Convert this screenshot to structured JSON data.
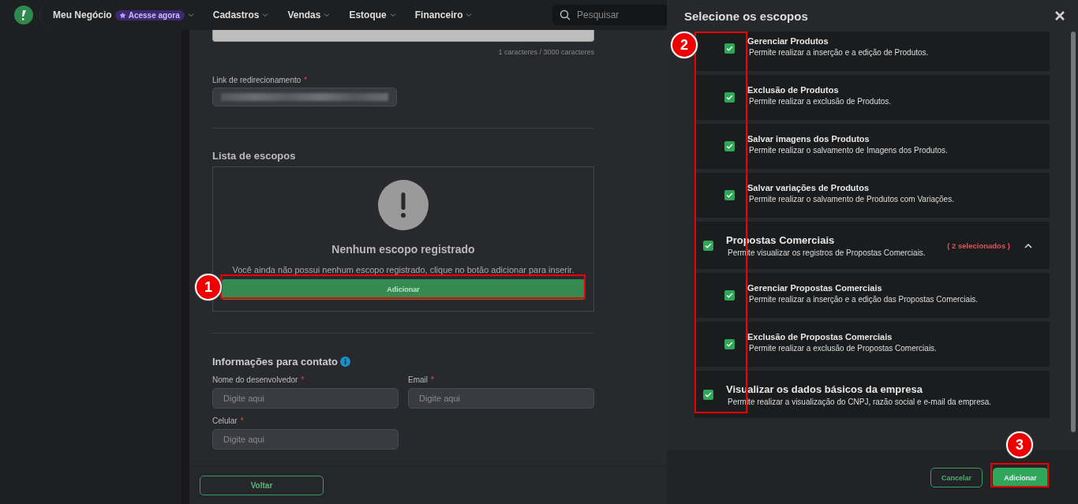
{
  "nav": {
    "brand_menu": {
      "label": "Meu Negócio",
      "badge": "Acesse agora"
    },
    "items": [
      {
        "label": "Cadastros"
      },
      {
        "label": "Vendas"
      },
      {
        "label": "Estoque"
      },
      {
        "label": "Financeiro"
      }
    ],
    "search": {
      "placeholder": "Pesquisar"
    }
  },
  "form": {
    "char_count": "1 caracteres / 3000 caracteres",
    "redirect": {
      "label": "Link de redirecionamento",
      "required_mark": "*"
    },
    "scopes_section": {
      "title": "Lista de escopos",
      "empty_title": "Nenhum escopo registrado",
      "empty_text": "Você ainda não possui nenhum escopo registrado, clique no botão adicionar para inserir.",
      "button": "Adicionar"
    },
    "contact": {
      "title": "Informações para contato",
      "fields": [
        {
          "label": "Nome do desenvolvedor",
          "required_mark": "*",
          "placeholder": "Digite aqui"
        },
        {
          "label": "Email",
          "required_mark": "*",
          "placeholder": "Digite aqui"
        },
        {
          "label": "Celular",
          "required_mark": "*",
          "placeholder": "Digite aqui"
        }
      ]
    },
    "back_button": "Voltar"
  },
  "drawer": {
    "title": "Selecione os escopos",
    "scopes": [
      {
        "kind": "sub",
        "title": "Gerenciar Produtos",
        "description": "Permite realizar a inserção e a edição de Produtos.",
        "checked": true
      },
      {
        "kind": "sub",
        "title": "Exclusão de Produtos",
        "description": "Permite realizar a exclusão de Produtos.",
        "checked": true
      },
      {
        "kind": "sub",
        "title": "Salvar imagens dos Produtos",
        "description": "Permite realizar o salvamento de Imagens dos Produtos.",
        "checked": true
      },
      {
        "kind": "sub",
        "title": "Salvar variações de Produtos",
        "description": "Permite realizar o salvamento de Produtos com Variações.",
        "checked": true
      },
      {
        "kind": "group",
        "title": "Propostas Comerciais",
        "description": "Permite visualizar os registros de Propostas Comerciais.",
        "checked": true,
        "count": "( 2 selecionados )",
        "expanded": true,
        "children": [
          {
            "kind": "sub",
            "title": "Gerenciar Propostas Comerciais",
            "description": "Permite realizar a inserção e a edição das Propostas Comerciais.",
            "checked": true
          },
          {
            "kind": "sub",
            "title": "Exclusão de Propostas Comerciais",
            "description": "Permite realizar a exclusão de Propostas Comerciais.",
            "checked": true
          }
        ]
      },
      {
        "kind": "group",
        "title": "Visualizar os dados básicos da empresa",
        "description": "Permite realizar a visualização do CNPJ, razão social e e-mail da empresa.",
        "checked": true
      }
    ],
    "buttons": [
      {
        "label": "Cancelar",
        "kind": "secondary"
      },
      {
        "label": "Adicionar",
        "kind": "primary"
      }
    ]
  },
  "annotations": [
    {
      "label": "1"
    },
    {
      "label": "2"
    },
    {
      "label": "3"
    }
  ]
}
